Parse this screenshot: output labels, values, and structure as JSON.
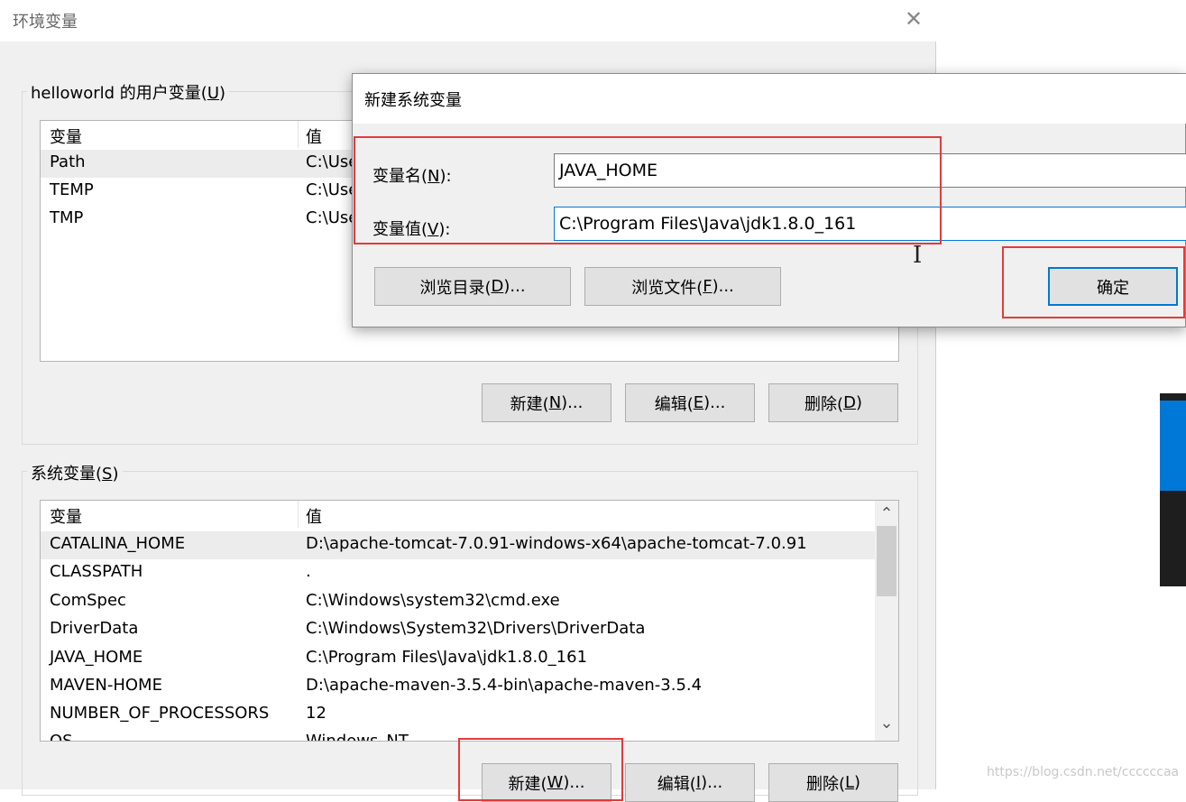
{
  "env_dialog": {
    "title": "环境变量",
    "close_glyph": "✕",
    "user_group": {
      "label_prefix": "helloworld 的用户变量(",
      "label_key": "U",
      "label_suffix": ")",
      "col_var": "变量",
      "col_val": "值",
      "rows": [
        {
          "name": "Path",
          "value": "C:\\Use"
        },
        {
          "name": "TEMP",
          "value": "C:\\Use"
        },
        {
          "name": "TMP",
          "value": "C:\\Use"
        }
      ],
      "buttons": [
        {
          "pre": "新建(",
          "key": "N",
          "post": ")..."
        },
        {
          "pre": "编辑(",
          "key": "E",
          "post": ")..."
        },
        {
          "pre": "删除(",
          "key": "D",
          "post": ")"
        }
      ]
    },
    "system_group": {
      "label_prefix": "系统变量(",
      "label_key": "S",
      "label_suffix": ")",
      "col_var": "变量",
      "col_val": "值",
      "rows": [
        {
          "name": "CATALINA_HOME",
          "value": "D:\\apache-tomcat-7.0.91-windows-x64\\apache-tomcat-7.0.91"
        },
        {
          "name": "CLASSPATH",
          "value": "."
        },
        {
          "name": "ComSpec",
          "value": "C:\\Windows\\system32\\cmd.exe"
        },
        {
          "name": "DriverData",
          "value": "C:\\Windows\\System32\\Drivers\\DriverData"
        },
        {
          "name": "JAVA_HOME",
          "value": "C:\\Program Files\\Java\\jdk1.8.0_161"
        },
        {
          "name": "MAVEN-HOME",
          "value": "D:\\apache-maven-3.5.4-bin\\apache-maven-3.5.4"
        },
        {
          "name": "NUMBER_OF_PROCESSORS",
          "value": "12"
        },
        {
          "name": "OS",
          "value": "Windows_NT"
        }
      ],
      "scroll_up": "⌃",
      "scroll_down": "⌄",
      "buttons": [
        {
          "pre": "新建(",
          "key": "W",
          "post": ")..."
        },
        {
          "pre": "编辑(",
          "key": "I",
          "post": ")..."
        },
        {
          "pre": "删除(",
          "key": "L",
          "post": ")"
        }
      ]
    }
  },
  "new_var_dialog": {
    "title": "新建系统变量",
    "name_label_pre": "变量名(",
    "name_label_key": "N",
    "name_label_post": "):",
    "name_value": "JAVA_HOME",
    "value_label_pre": "变量值(",
    "value_label_key": "V",
    "value_label_post": "):",
    "value_value": "C:\\Program Files\\Java\\jdk1.8.0_161",
    "browse_dir": {
      "pre": "浏览目录(",
      "key": "D",
      "post": ")..."
    },
    "browse_file": {
      "pre": "浏览文件(",
      "key": "F",
      "post": ")..."
    },
    "ok": "确定"
  },
  "cursor_glyph": "I",
  "watermark": "https://blog.csdn.net/ccccccaa"
}
